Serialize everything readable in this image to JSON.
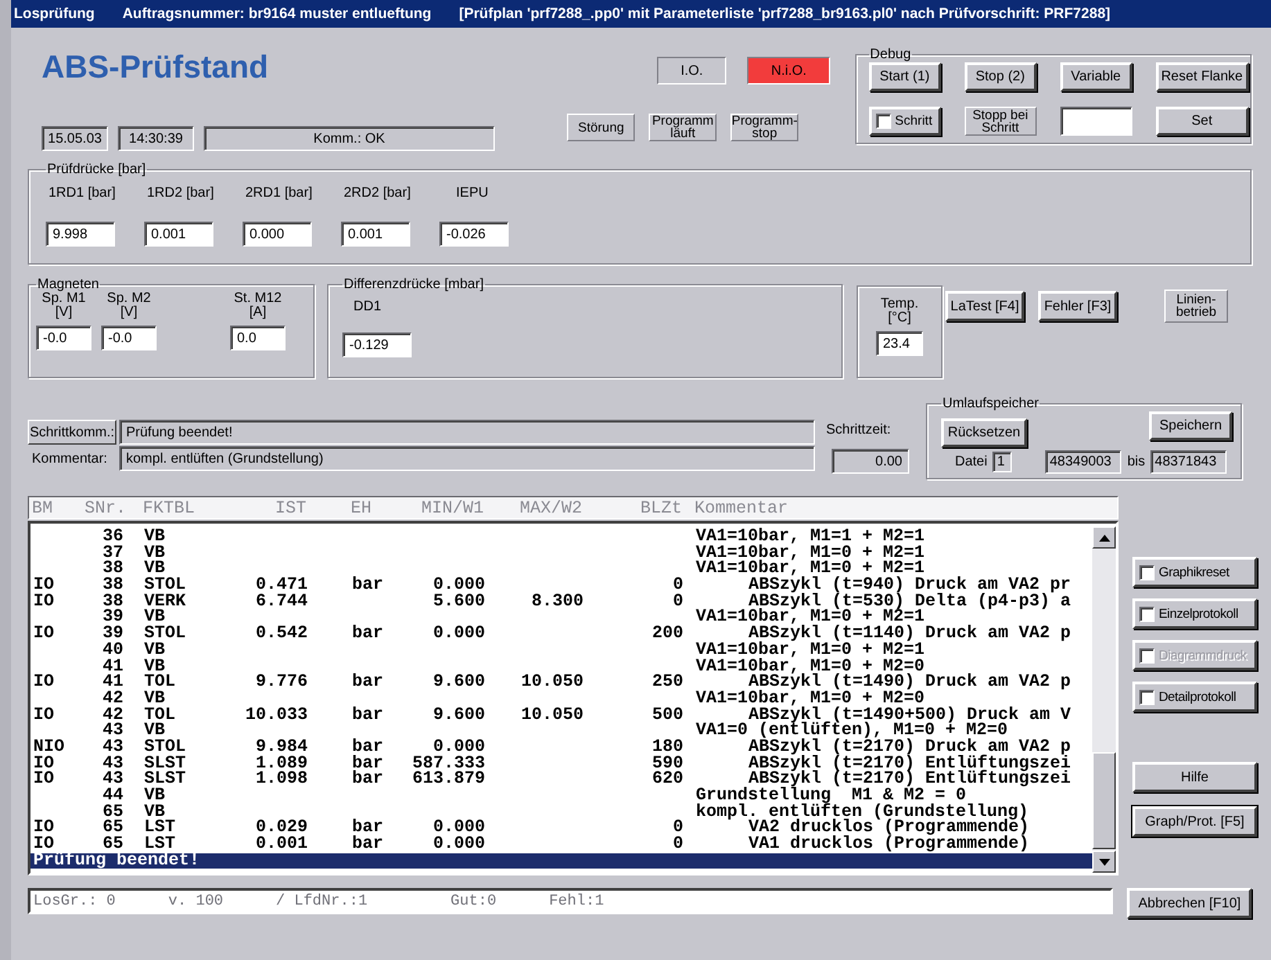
{
  "window": {
    "title_parts": [
      "Losprüfung",
      "Auftragsnummer: br9164 muster entlueftung",
      "[Prüfplan 'prf7288_.pp0' mit Parameterliste 'prf7288_br9163.pl0' nach Prüfvorschrift: PRF7288]"
    ]
  },
  "header": {
    "app_title": "ABS-Prüfstand",
    "date": "15.05.03",
    "time": "14:30:39",
    "status": "Komm.: OK"
  },
  "indicators": [
    {
      "label": "I.O.",
      "on": false
    },
    {
      "label": "N.i.O.",
      "on": true
    }
  ],
  "lamps": [
    {
      "label": "Störung"
    },
    {
      "label": "Programm läuft"
    },
    {
      "label": "Programm-stop"
    }
  ],
  "debug": {
    "title": "Debug",
    "buttons": [
      "Start (1)",
      "Stop (2)",
      "Variable",
      "Reset Flanke"
    ],
    "step": {
      "label": "Schritt",
      "checked": false
    },
    "stop_label": "Stopp bei Schritt",
    "set_button": "Set"
  },
  "pruefdruecke": {
    "title": "Prüfdrücke [bar]",
    "channels": [
      {
        "label": "1RD1 [bar]",
        "value": "9.998"
      },
      {
        "label": "1RD2 [bar]",
        "value": "0.001"
      },
      {
        "label": "2RD1 [bar]",
        "value": "0.000"
      },
      {
        "label": "2RD2 [bar]",
        "value": "0.001"
      },
      {
        "label": "IEPU",
        "value": "-0.026"
      }
    ]
  },
  "magneten": {
    "title": "Magneten",
    "channels": [
      {
        "label": "Sp. M1",
        "unit": "[V]",
        "value": "-0.0"
      },
      {
        "label": "Sp. M2",
        "unit": "[V]",
        "value": "-0.0"
      },
      {
        "label": "St. M12",
        "unit": "[A]",
        "value": "0.0"
      }
    ]
  },
  "differenzdruecke": {
    "title": "Differenzdrücke [mbar]",
    "channels": [
      {
        "label": "DD1",
        "value": "-0.129"
      }
    ]
  },
  "temperature": {
    "label": "Temp.",
    "unit": "[°C]",
    "value": "23.4"
  },
  "function_buttons": [
    "LaTest [F4]",
    "Fehler [F3]"
  ],
  "mode_label": "Linien-betrieb",
  "step": {
    "button": "Schrittkomm.:",
    "message": "Prüfung beendet!",
    "comment_label": "Kommentar:",
    "comment": "kompl. entlüften (Grundstellung)",
    "time_label": "Schrittzeit:",
    "time": "0.00"
  },
  "umlaufspeicher": {
    "title": "Umlaufspeicher",
    "reset_button": "Rücksetzen",
    "save_button": "Speichern",
    "file_label": "Datei",
    "file": "1",
    "from": "48349003",
    "to_label": "bis",
    "to": "48371843"
  },
  "listing": {
    "columns": [
      "BM",
      "SNr.",
      "FKTBL",
      "IST",
      "EH",
      "MIN/W1",
      "MAX/W2",
      "BLZt",
      "Kommentar"
    ],
    "rows": [
      {
        "kind": "data",
        "selected": false,
        "snr": "36",
        "fktbl": "VB",
        "kommentar": "VA1=10bar, M1=1 + M2=1",
        "indented": false
      },
      {
        "kind": "data",
        "selected": false,
        "snr": "37",
        "fktbl": "VB",
        "kommentar": "VA1=10bar, M1=0 + M2=1",
        "indented": false
      },
      {
        "kind": "data",
        "selected": false,
        "snr": "38",
        "fktbl": "VB",
        "kommentar": "VA1=10bar, M1=0 + M2=1",
        "indented": false
      },
      {
        "kind": "data",
        "selected": false,
        "bm": "IO",
        "snr": "38",
        "fktbl": "STOL",
        "ist": "0.471",
        "eh": "bar",
        "min_w1": "0.000",
        "blzt": "0",
        "kommentar": "ABSzykl (t=940) Druck am VA2 pr",
        "indented": true
      },
      {
        "kind": "data",
        "selected": false,
        "bm": "IO",
        "snr": "38",
        "fktbl": "VERK",
        "ist": "6.744",
        "min_w1": "5.600",
        "max_w2": "8.300",
        "blzt": "0",
        "kommentar": "ABSzykl (t=530) Delta (p4-p3) a",
        "indented": true
      },
      {
        "kind": "data",
        "selected": false,
        "snr": "39",
        "fktbl": "VB",
        "kommentar": "VA1=10bar, M1=0 + M2=1",
        "indented": false
      },
      {
        "kind": "data",
        "selected": false,
        "bm": "IO",
        "snr": "39",
        "fktbl": "STOL",
        "ist": "0.542",
        "eh": "bar",
        "min_w1": "0.000",
        "blzt": "200",
        "kommentar": "ABSzykl (t=1140) Druck am VA2 p",
        "indented": true
      },
      {
        "kind": "data",
        "selected": false,
        "snr": "40",
        "fktbl": "VB",
        "kommentar": "VA1=10bar, M1=0 + M2=1",
        "indented": false
      },
      {
        "kind": "data",
        "selected": false,
        "snr": "41",
        "fktbl": "VB",
        "kommentar": "VA1=10bar, M1=0 + M2=0",
        "indented": false
      },
      {
        "kind": "data",
        "selected": false,
        "bm": "IO",
        "snr": "41",
        "fktbl": "TOL",
        "ist": "9.776",
        "eh": "bar",
        "min_w1": "9.600",
        "max_w2": "10.050",
        "blzt": "250",
        "kommentar": "ABSzykl (t=1490) Druck am VA2 p",
        "indented": true
      },
      {
        "kind": "data",
        "selected": false,
        "snr": "42",
        "fktbl": "VB",
        "kommentar": "VA1=10bar, M1=0 + M2=0",
        "indented": false
      },
      {
        "kind": "data",
        "selected": false,
        "bm": "IO",
        "snr": "42",
        "fktbl": "TOL",
        "ist": "10.033",
        "eh": "bar",
        "min_w1": "9.600",
        "max_w2": "10.050",
        "blzt": "500",
        "kommentar": "ABSzykl (t=1490+500) Druck am V",
        "indented": true
      },
      {
        "kind": "data",
        "selected": false,
        "snr": "43",
        "fktbl": "VB",
        "kommentar": "VA1=0 (entlüften), M1=0 + M2=0",
        "indented": false
      },
      {
        "kind": "data",
        "selected": false,
        "bm": "NIO",
        "snr": "43",
        "fktbl": "STOL",
        "ist": "9.984",
        "eh": "bar",
        "min_w1": "0.000",
        "blzt": "180",
        "kommentar": "ABSzykl (t=2170) Druck am VA2 p",
        "indented": true
      },
      {
        "kind": "data",
        "selected": false,
        "bm": "IO",
        "snr": "43",
        "fktbl": "SLST",
        "ist": "1.089",
        "eh": "bar",
        "min_w1": "587.333",
        "blzt": "590",
        "kommentar": "ABSzykl (t=2170) Entlüftungszei",
        "indented": true
      },
      {
        "kind": "data",
        "selected": false,
        "bm": "IO",
        "snr": "43",
        "fktbl": "SLST",
        "ist": "1.098",
        "eh": "bar",
        "min_w1": "613.879",
        "blzt": "620",
        "kommentar": "ABSzykl (t=2170) Entlüftungszei",
        "indented": true
      },
      {
        "kind": "data",
        "selected": false,
        "snr": "44",
        "fktbl": "VB",
        "kommentar": "Grundstellung  M1 & M2 = 0",
        "indented": false
      },
      {
        "kind": "data",
        "selected": false,
        "snr": "65",
        "fktbl": "VB",
        "kommentar": "kompl. entlüften (Grundstellung)",
        "indented": false
      },
      {
        "kind": "data",
        "selected": false,
        "bm": "IO",
        "snr": "65",
        "fktbl": "LST",
        "ist": "0.029",
        "eh": "bar",
        "min_w1": "0.000",
        "blzt": "0",
        "kommentar": "VA2 drucklos (Programmende)",
        "indented": true
      },
      {
        "kind": "data",
        "selected": false,
        "bm": "IO",
        "snr": "65",
        "fktbl": "LST",
        "ist": "0.001",
        "eh": "bar",
        "min_w1": "0.000",
        "blzt": "0",
        "kommentar": "VA1 drucklos (Programmende)",
        "indented": true
      },
      {
        "kind": "message",
        "selected": true,
        "text": "Prüfung beendet!"
      }
    ]
  },
  "options": [
    {
      "label": "Graphikreset",
      "checked": false,
      "disabled": false
    },
    {
      "label": "Einzelprotokoll",
      "checked": false,
      "disabled": false
    },
    {
      "label": "Diagrammdruck",
      "checked": false,
      "disabled": true
    },
    {
      "label": "Detailprotokoll",
      "checked": false,
      "disabled": false
    }
  ],
  "side_buttons": [
    {
      "label": "Hilfe",
      "default": false
    },
    {
      "label": "Graph/Prot. [F5]",
      "default": true
    }
  ],
  "status_line": [
    "LosGr.: 0",
    "v. 100",
    "/ LfdNr.:1",
    "Gut:0",
    "Fehl:1"
  ],
  "cancel_button": "Abbrechen [F10]"
}
